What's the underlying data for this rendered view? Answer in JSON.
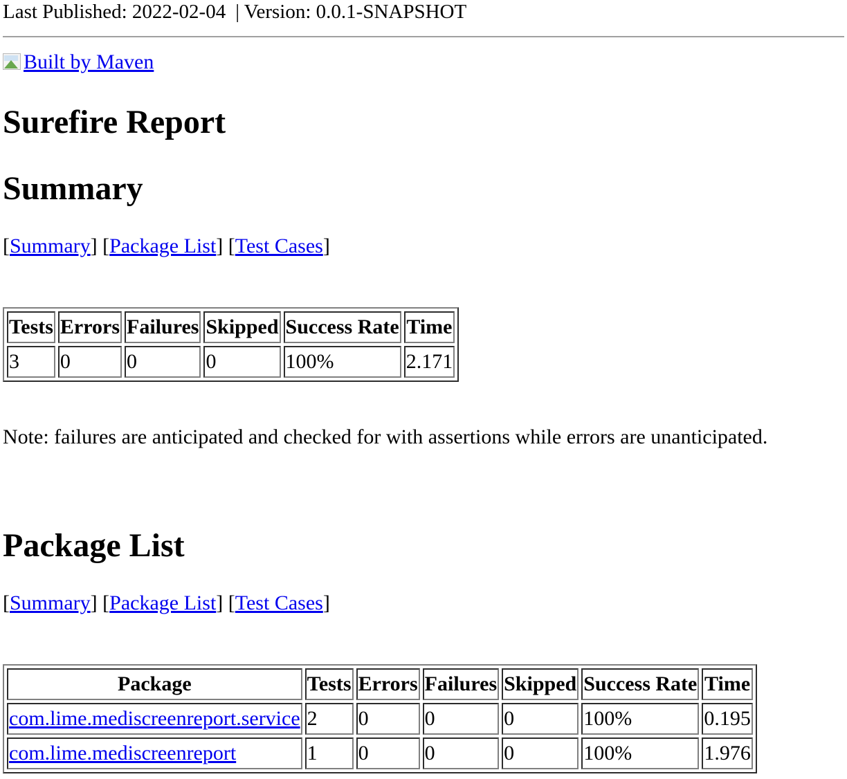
{
  "banner": {
    "published": "Last Published: 2022-02-04",
    "separator": "|",
    "version": "Version: 0.0.1-SNAPSHOT"
  },
  "maven_badge": {
    "alt_text": "Built by Maven"
  },
  "headings": {
    "report_title": "Surefire Report",
    "summary": "Summary",
    "package_list": "Package List"
  },
  "nav": {
    "summary": "Summary",
    "package_list": "Package List",
    "test_cases": "Test Cases"
  },
  "summary_table": {
    "headers": [
      "Tests",
      "Errors",
      "Failures",
      "Skipped",
      "Success Rate",
      "Time"
    ],
    "rows": [
      [
        "3",
        "0",
        "0",
        "0",
        "100%",
        "2.171"
      ]
    ]
  },
  "note": "Note: failures are anticipated and checked for with assertions while errors are unanticipated.",
  "package_table": {
    "headers": [
      "Package",
      "Tests",
      "Errors",
      "Failures",
      "Skipped",
      "Success Rate",
      "Time"
    ],
    "rows": [
      [
        "com.lime.mediscreenreport.service",
        "2",
        "0",
        "0",
        "0",
        "100%",
        "0.195"
      ],
      [
        "com.lime.mediscreenreport",
        "1",
        "0",
        "0",
        "0",
        "100%",
        "1.976"
      ]
    ]
  },
  "colors": {
    "link": "#0000ee",
    "text": "#000000",
    "rule": "#a0a0a0"
  }
}
